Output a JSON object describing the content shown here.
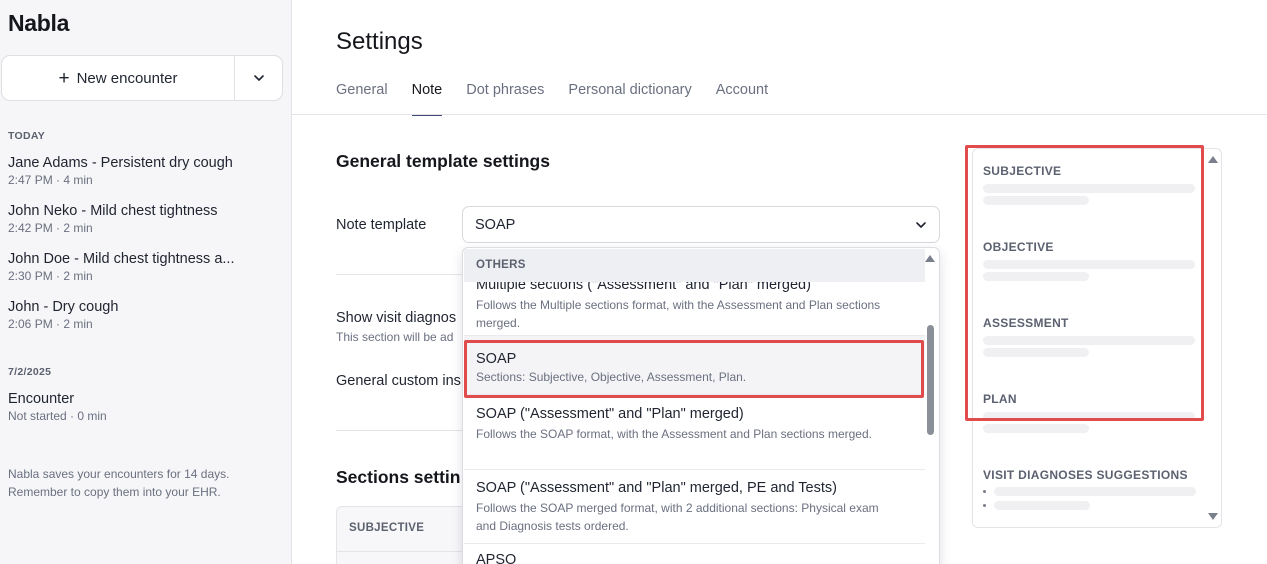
{
  "sidebar": {
    "brand": "Nabla",
    "new_encounter_label": "New encounter",
    "groups": [
      {
        "label": "TODAY",
        "items": [
          {
            "title": "Jane Adams - Persistent dry cough",
            "meta": "2:47 PM · 4 min"
          },
          {
            "title": "John Neko - Mild chest tightness",
            "meta": "2:42 PM · 2 min"
          },
          {
            "title": "John Doe - Mild chest tightness a...",
            "meta": "2:30 PM · 2 min"
          },
          {
            "title": "John - Dry cough",
            "meta": "2:06 PM · 2 min"
          }
        ]
      },
      {
        "label": "7/2/2025",
        "items": [
          {
            "title": "Encounter",
            "meta": "Not started · 0 min"
          }
        ]
      }
    ],
    "notice_line1": "Nabla saves your encounters for 14 days.",
    "notice_line2": "Remember to copy them into your EHR."
  },
  "main": {
    "title": "Settings",
    "tabs": [
      {
        "label": "General"
      },
      {
        "label": "Note",
        "active": true
      },
      {
        "label": "Dot phrases"
      },
      {
        "label": "Personal dictionary"
      },
      {
        "label": "Account"
      }
    ],
    "general_heading": "General template settings",
    "note_template_label": "Note template",
    "note_template_value": "SOAP",
    "visit_diagnoses_label": "Show visit diagnos",
    "visit_diagnoses_sub": "This section will be ad",
    "custom_instructions_label": "General custom ins",
    "sections_heading": "Sections settin",
    "sections_table_header": "SUBJECTIVE"
  },
  "dropdown": {
    "group_label": "OTHERS",
    "options": [
      {
        "title": "Multiple sections (\"Assessment\" and \"Plan\" merged)",
        "desc": "Follows the Multiple sections format, with the Assessment and Plan sections merged."
      },
      {
        "title": "SOAP",
        "desc": "Sections: Subjective, Objective, Assessment, Plan.",
        "selected": true
      },
      {
        "title": "SOAP (\"Assessment\" and \"Plan\" merged)",
        "desc": "Follows the SOAP format, with the Assessment and Plan sections merged."
      },
      {
        "title": "SOAP (\"Assessment\" and \"Plan\" merged, PE and Tests)",
        "desc": "Follows the SOAP merged format, with 2 additional sections: Physical exam and Diagnosis tests ordered."
      },
      {
        "title": "APSO",
        "desc": ""
      }
    ]
  },
  "preview": {
    "sections": [
      {
        "title": "SUBJECTIVE"
      },
      {
        "title": "OBJECTIVE"
      },
      {
        "title": "ASSESSMENT"
      },
      {
        "title": "PLAN"
      },
      {
        "title": "VISIT DIAGNOSES SUGGESTIONS"
      }
    ]
  },
  "colors": {
    "accent": "#3d4a78",
    "highlight": "#e04b4b",
    "sidebar_bg": "#f6f6f8"
  }
}
